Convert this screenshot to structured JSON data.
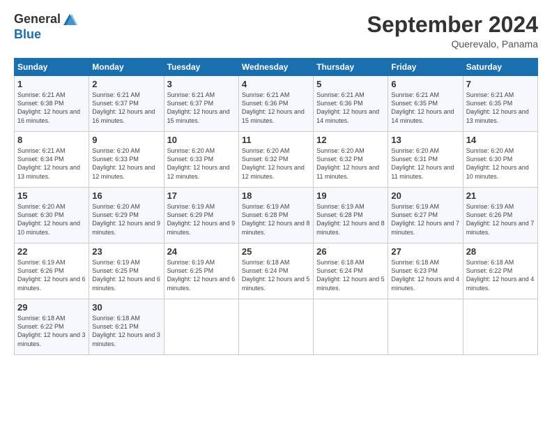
{
  "header": {
    "logo_general": "General",
    "logo_blue": "Blue",
    "month": "September 2024",
    "location": "Querevalo, Panama"
  },
  "weekdays": [
    "Sunday",
    "Monday",
    "Tuesday",
    "Wednesday",
    "Thursday",
    "Friday",
    "Saturday"
  ],
  "weeks": [
    [
      {
        "day": "1",
        "sunrise": "6:21 AM",
        "sunset": "6:38 PM",
        "daylight": "12 hours and 16 minutes."
      },
      {
        "day": "2",
        "sunrise": "6:21 AM",
        "sunset": "6:37 PM",
        "daylight": "12 hours and 16 minutes."
      },
      {
        "day": "3",
        "sunrise": "6:21 AM",
        "sunset": "6:37 PM",
        "daylight": "12 hours and 15 minutes."
      },
      {
        "day": "4",
        "sunrise": "6:21 AM",
        "sunset": "6:36 PM",
        "daylight": "12 hours and 15 minutes."
      },
      {
        "day": "5",
        "sunrise": "6:21 AM",
        "sunset": "6:36 PM",
        "daylight": "12 hours and 14 minutes."
      },
      {
        "day": "6",
        "sunrise": "6:21 AM",
        "sunset": "6:35 PM",
        "daylight": "12 hours and 14 minutes."
      },
      {
        "day": "7",
        "sunrise": "6:21 AM",
        "sunset": "6:35 PM",
        "daylight": "12 hours and 13 minutes."
      }
    ],
    [
      {
        "day": "8",
        "sunrise": "6:21 AM",
        "sunset": "6:34 PM",
        "daylight": "12 hours and 13 minutes."
      },
      {
        "day": "9",
        "sunrise": "6:20 AM",
        "sunset": "6:33 PM",
        "daylight": "12 hours and 12 minutes."
      },
      {
        "day": "10",
        "sunrise": "6:20 AM",
        "sunset": "6:33 PM",
        "daylight": "12 hours and 12 minutes."
      },
      {
        "day": "11",
        "sunrise": "6:20 AM",
        "sunset": "6:32 PM",
        "daylight": "12 hours and 12 minutes."
      },
      {
        "day": "12",
        "sunrise": "6:20 AM",
        "sunset": "6:32 PM",
        "daylight": "12 hours and 11 minutes."
      },
      {
        "day": "13",
        "sunrise": "6:20 AM",
        "sunset": "6:31 PM",
        "daylight": "12 hours and 11 minutes."
      },
      {
        "day": "14",
        "sunrise": "6:20 AM",
        "sunset": "6:30 PM",
        "daylight": "12 hours and 10 minutes."
      }
    ],
    [
      {
        "day": "15",
        "sunrise": "6:20 AM",
        "sunset": "6:30 PM",
        "daylight": "12 hours and 10 minutes."
      },
      {
        "day": "16",
        "sunrise": "6:20 AM",
        "sunset": "6:29 PM",
        "daylight": "12 hours and 9 minutes."
      },
      {
        "day": "17",
        "sunrise": "6:19 AM",
        "sunset": "6:29 PM",
        "daylight": "12 hours and 9 minutes."
      },
      {
        "day": "18",
        "sunrise": "6:19 AM",
        "sunset": "6:28 PM",
        "daylight": "12 hours and 8 minutes."
      },
      {
        "day": "19",
        "sunrise": "6:19 AM",
        "sunset": "6:28 PM",
        "daylight": "12 hours and 8 minutes."
      },
      {
        "day": "20",
        "sunrise": "6:19 AM",
        "sunset": "6:27 PM",
        "daylight": "12 hours and 7 minutes."
      },
      {
        "day": "21",
        "sunrise": "6:19 AM",
        "sunset": "6:26 PM",
        "daylight": "12 hours and 7 minutes."
      }
    ],
    [
      {
        "day": "22",
        "sunrise": "6:19 AM",
        "sunset": "6:26 PM",
        "daylight": "12 hours and 6 minutes."
      },
      {
        "day": "23",
        "sunrise": "6:19 AM",
        "sunset": "6:25 PM",
        "daylight": "12 hours and 6 minutes."
      },
      {
        "day": "24",
        "sunrise": "6:19 AM",
        "sunset": "6:25 PM",
        "daylight": "12 hours and 6 minutes."
      },
      {
        "day": "25",
        "sunrise": "6:18 AM",
        "sunset": "6:24 PM",
        "daylight": "12 hours and 5 minutes."
      },
      {
        "day": "26",
        "sunrise": "6:18 AM",
        "sunset": "6:24 PM",
        "daylight": "12 hours and 5 minutes."
      },
      {
        "day": "27",
        "sunrise": "6:18 AM",
        "sunset": "6:23 PM",
        "daylight": "12 hours and 4 minutes."
      },
      {
        "day": "28",
        "sunrise": "6:18 AM",
        "sunset": "6:22 PM",
        "daylight": "12 hours and 4 minutes."
      }
    ],
    [
      {
        "day": "29",
        "sunrise": "6:18 AM",
        "sunset": "6:22 PM",
        "daylight": "12 hours and 3 minutes."
      },
      {
        "day": "30",
        "sunrise": "6:18 AM",
        "sunset": "6:21 PM",
        "daylight": "12 hours and 3 minutes."
      },
      null,
      null,
      null,
      null,
      null
    ]
  ]
}
